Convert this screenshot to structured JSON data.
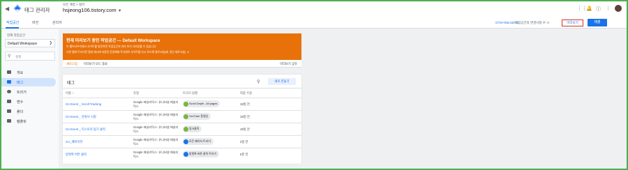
{
  "header": {
    "product": "태그 관리자",
    "breadcrumb": "모든 계정 > 힐러",
    "account": "hsjeong106.tistory.com"
  },
  "tabs": [
    "작업공간",
    "버전",
    "관리자"
  ],
  "toolbar": {
    "container_id": "GTM-NNLNZNG",
    "changes": "작업공간의 변경사항 수: 0",
    "preview": "미리보기",
    "submit": "제출"
  },
  "sidebar": {
    "ws_label": "현재 작업공간",
    "ws_name": "Default Workspace",
    "search_placeholder": "검색",
    "items": [
      {
        "label": "개요",
        "active": false
      },
      {
        "label": "태그",
        "active": true
      },
      {
        "label": "트리거",
        "active": false
      },
      {
        "label": "변수",
        "active": false
      },
      {
        "label": "폴더",
        "active": false
      },
      {
        "label": "템플릿",
        "active": false
      }
    ]
  },
  "banner": {
    "title": "현재 미리보기 중인 작업공간 — Default Workspace",
    "line1": "이 웹브라우저에서 사이트를 방문하면 작업공간의 미리 보기 디버깅할 수 있습니다.",
    "line2": "다른 탭에 트리거된 탭내 캐시에 저장된 운영체제 주사위로 사이트를 다시 로드해 새로고침(제, 갱신 새로고침). ①",
    "refresh": "새로고침",
    "hide_debug": "미리보기 모드 종료",
    "share": "미리보기 공유"
  },
  "tags_card": {
    "title": "태그",
    "new_button": "새로 만들기",
    "columns": [
      "이름 ↑",
      "유형",
      "트리거 실행",
      "최종 수정"
    ],
    "rows": [
      {
        "name": "GA Event _ Scroll Tracking",
        "type": "Google 애널리틱스: 유니버설 애널리틱스",
        "trigger": "Scroll Depth - All pages",
        "trigger_color": "#7cb342",
        "edited": "19일 전"
      },
      {
        "name": "GA Event _ 유튜브 시청",
        "type": "Google 애널리틱스: 유니버설 애널리틱스",
        "trigger": "YouTube 동영상",
        "trigger_color": "#7cb342",
        "edited": "19일 전"
      },
      {
        "name": "GA Event _ 티스토리 링크 클릭",
        "type": "Google 애널리틱스: 유니버설 애널리틱스",
        "trigger": "링크클릭",
        "trigger_color": "#7cb342",
        "edited": "19일 전"
      },
      {
        "name": "GA_페이지뷰",
        "type": "Google 애널리틱스: 유니버설 애널리틱스",
        "trigger": "모든 페이지 트리거",
        "trigger_color": "#1a73e8",
        "edited": "2일 전"
      },
      {
        "name": "방명록 버튼 클릭",
        "type": "Google 애널리틱스: 유니버설 애널리틱스",
        "trigger": "방명록 버튼 클릭 트리거",
        "trigger_color": "#1a73e8",
        "edited": "5분 전"
      }
    ]
  }
}
